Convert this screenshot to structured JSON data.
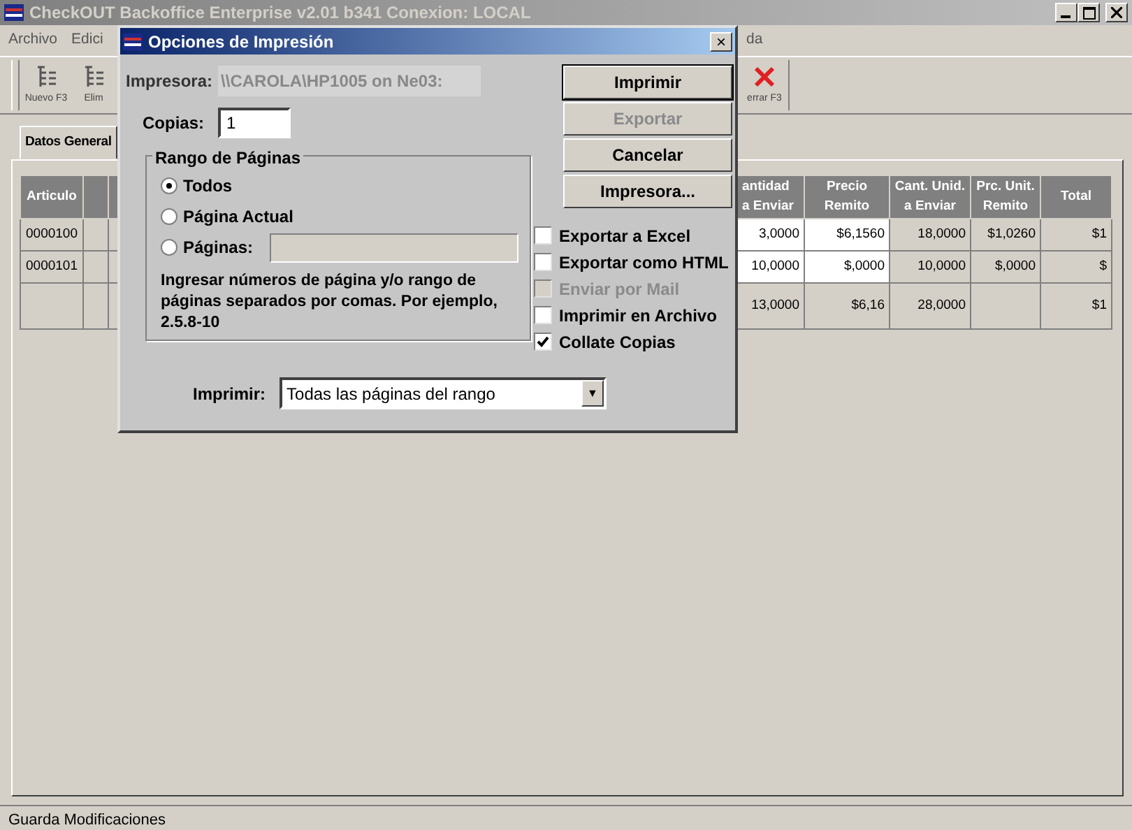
{
  "app": {
    "title": "CheckOUT Backoffice Enterprise v2.01 b341 Conexion: LOCAL",
    "menu": [
      "Archivo",
      "Edici",
      "da"
    ],
    "toolbar_left": [
      "Nuevo F3",
      "Elim"
    ],
    "toolbar_right": [
      "errar F3"
    ],
    "tab": {
      "label": "Datos General",
      "selected": true
    },
    "table": {
      "left_columns": [
        {
          "lines": [
            "Articulo"
          ]
        }
      ],
      "right_columns": [
        {
          "lines": [
            "antidad",
            "a Enviar"
          ],
          "editable": true
        },
        {
          "lines": [
            "Precio",
            "Remito"
          ],
          "editable": true
        },
        {
          "lines": [
            "Cant. Unid.",
            "a Enviar"
          ],
          "editable": false
        },
        {
          "lines": [
            "Prc. Unit.",
            "Remito"
          ],
          "editable": false
        },
        {
          "lines": [
            "Total"
          ],
          "editable": false
        }
      ],
      "rows": [
        {
          "kind": "item",
          "articulo": "0000100",
          "cells": [
            "3,0000",
            "$6,1560",
            "18,0000",
            "$1,0260",
            "$1"
          ]
        },
        {
          "kind": "item",
          "articulo": "0000101",
          "cells": [
            "10,0000",
            "$,0000",
            "10,0000",
            "$,0000",
            "$"
          ]
        },
        {
          "kind": "total",
          "cells": [
            "13,0000",
            "$6,16",
            "28,0000",
            null,
            "$1"
          ]
        }
      ]
    },
    "status_bar": "Guarda Modificaciones"
  },
  "dialog": {
    "title": "Opciones de Impresión",
    "close": "×",
    "printer_label": "Impresora:",
    "printer": "\\\\CAROLA\\HP1005 on Ne03:",
    "copies_label": "Copias:",
    "copies": "1",
    "buttons": [
      {
        "label": "Imprimir",
        "default": true,
        "disabled": false
      },
      {
        "label": "Exportar",
        "default": false,
        "disabled": true
      },
      {
        "label": "Cancelar",
        "default": false,
        "disabled": false
      },
      {
        "label": "Impresora...",
        "default": false,
        "disabled": false
      }
    ],
    "range": {
      "legend": "Rango de Páginas",
      "options": [
        {
          "label": "Todos",
          "selected": true,
          "kind": "plain"
        },
        {
          "label": "Página Actual",
          "selected": false,
          "kind": "plain"
        },
        {
          "label": "Páginas:",
          "selected": false,
          "kind": "field"
        }
      ],
      "help": "Ingresar números de página y/o rango de páginas separados por comas. Por ejemplo, 2.5.8-10"
    },
    "options": [
      {
        "label": "Exportar a Excel",
        "checked": false,
        "disabled": false
      },
      {
        "label": "Exportar como HTML",
        "checked": false,
        "disabled": false
      },
      {
        "label": "Enviar por Mail",
        "checked": false,
        "disabled": true
      },
      {
        "label": "Imprimir en Archivo",
        "checked": false,
        "disabled": false
      },
      {
        "label": "Collate Copias",
        "checked": true,
        "disabled": false
      }
    ],
    "print_label": "Imprimir:",
    "print_value": "Todas las páginas del rango",
    "dropdown_arrow": "▼"
  }
}
